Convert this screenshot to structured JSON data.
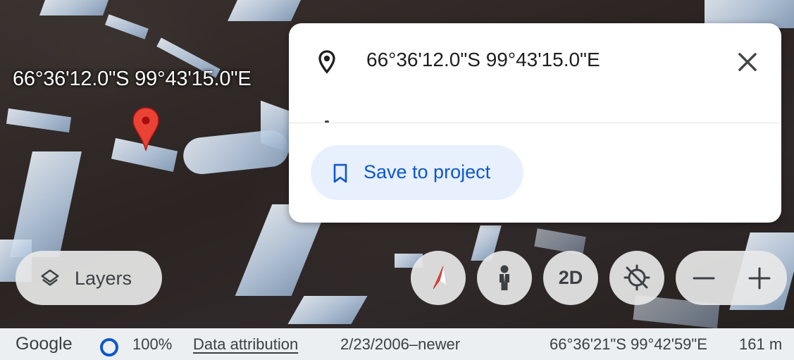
{
  "map": {
    "location_label": "66°36'12.0\"S 99°43'15.0\"E",
    "pin_color": "#ea4335"
  },
  "info_card": {
    "title": "66°36'12.0\"S 99°43'15.0\"E",
    "icon": "location-pin-icon",
    "close_icon": "close-icon",
    "save_button": {
      "label": "Save to project",
      "icon": "bookmark-icon",
      "color": "#0b57d0",
      "background": "#e8f0fe"
    }
  },
  "controls": {
    "layers_label": "Layers",
    "view_mode_label": "2D",
    "compass_icon": "compass-icon",
    "pegman_icon": "pegman-icon",
    "locate_icon": "my-location-icon",
    "zoom_out_icon": "minus-icon",
    "zoom_in_icon": "plus-icon"
  },
  "status_bar": {
    "logo": "Google",
    "zoom_percent": "100%",
    "attribution": "Data attribution",
    "imagery_date": "2/23/2006–newer",
    "cursor_coords": "66°36'21\"S 99°42'59\"E",
    "altitude": "161 m",
    "ring_color": "#0b57d0"
  }
}
